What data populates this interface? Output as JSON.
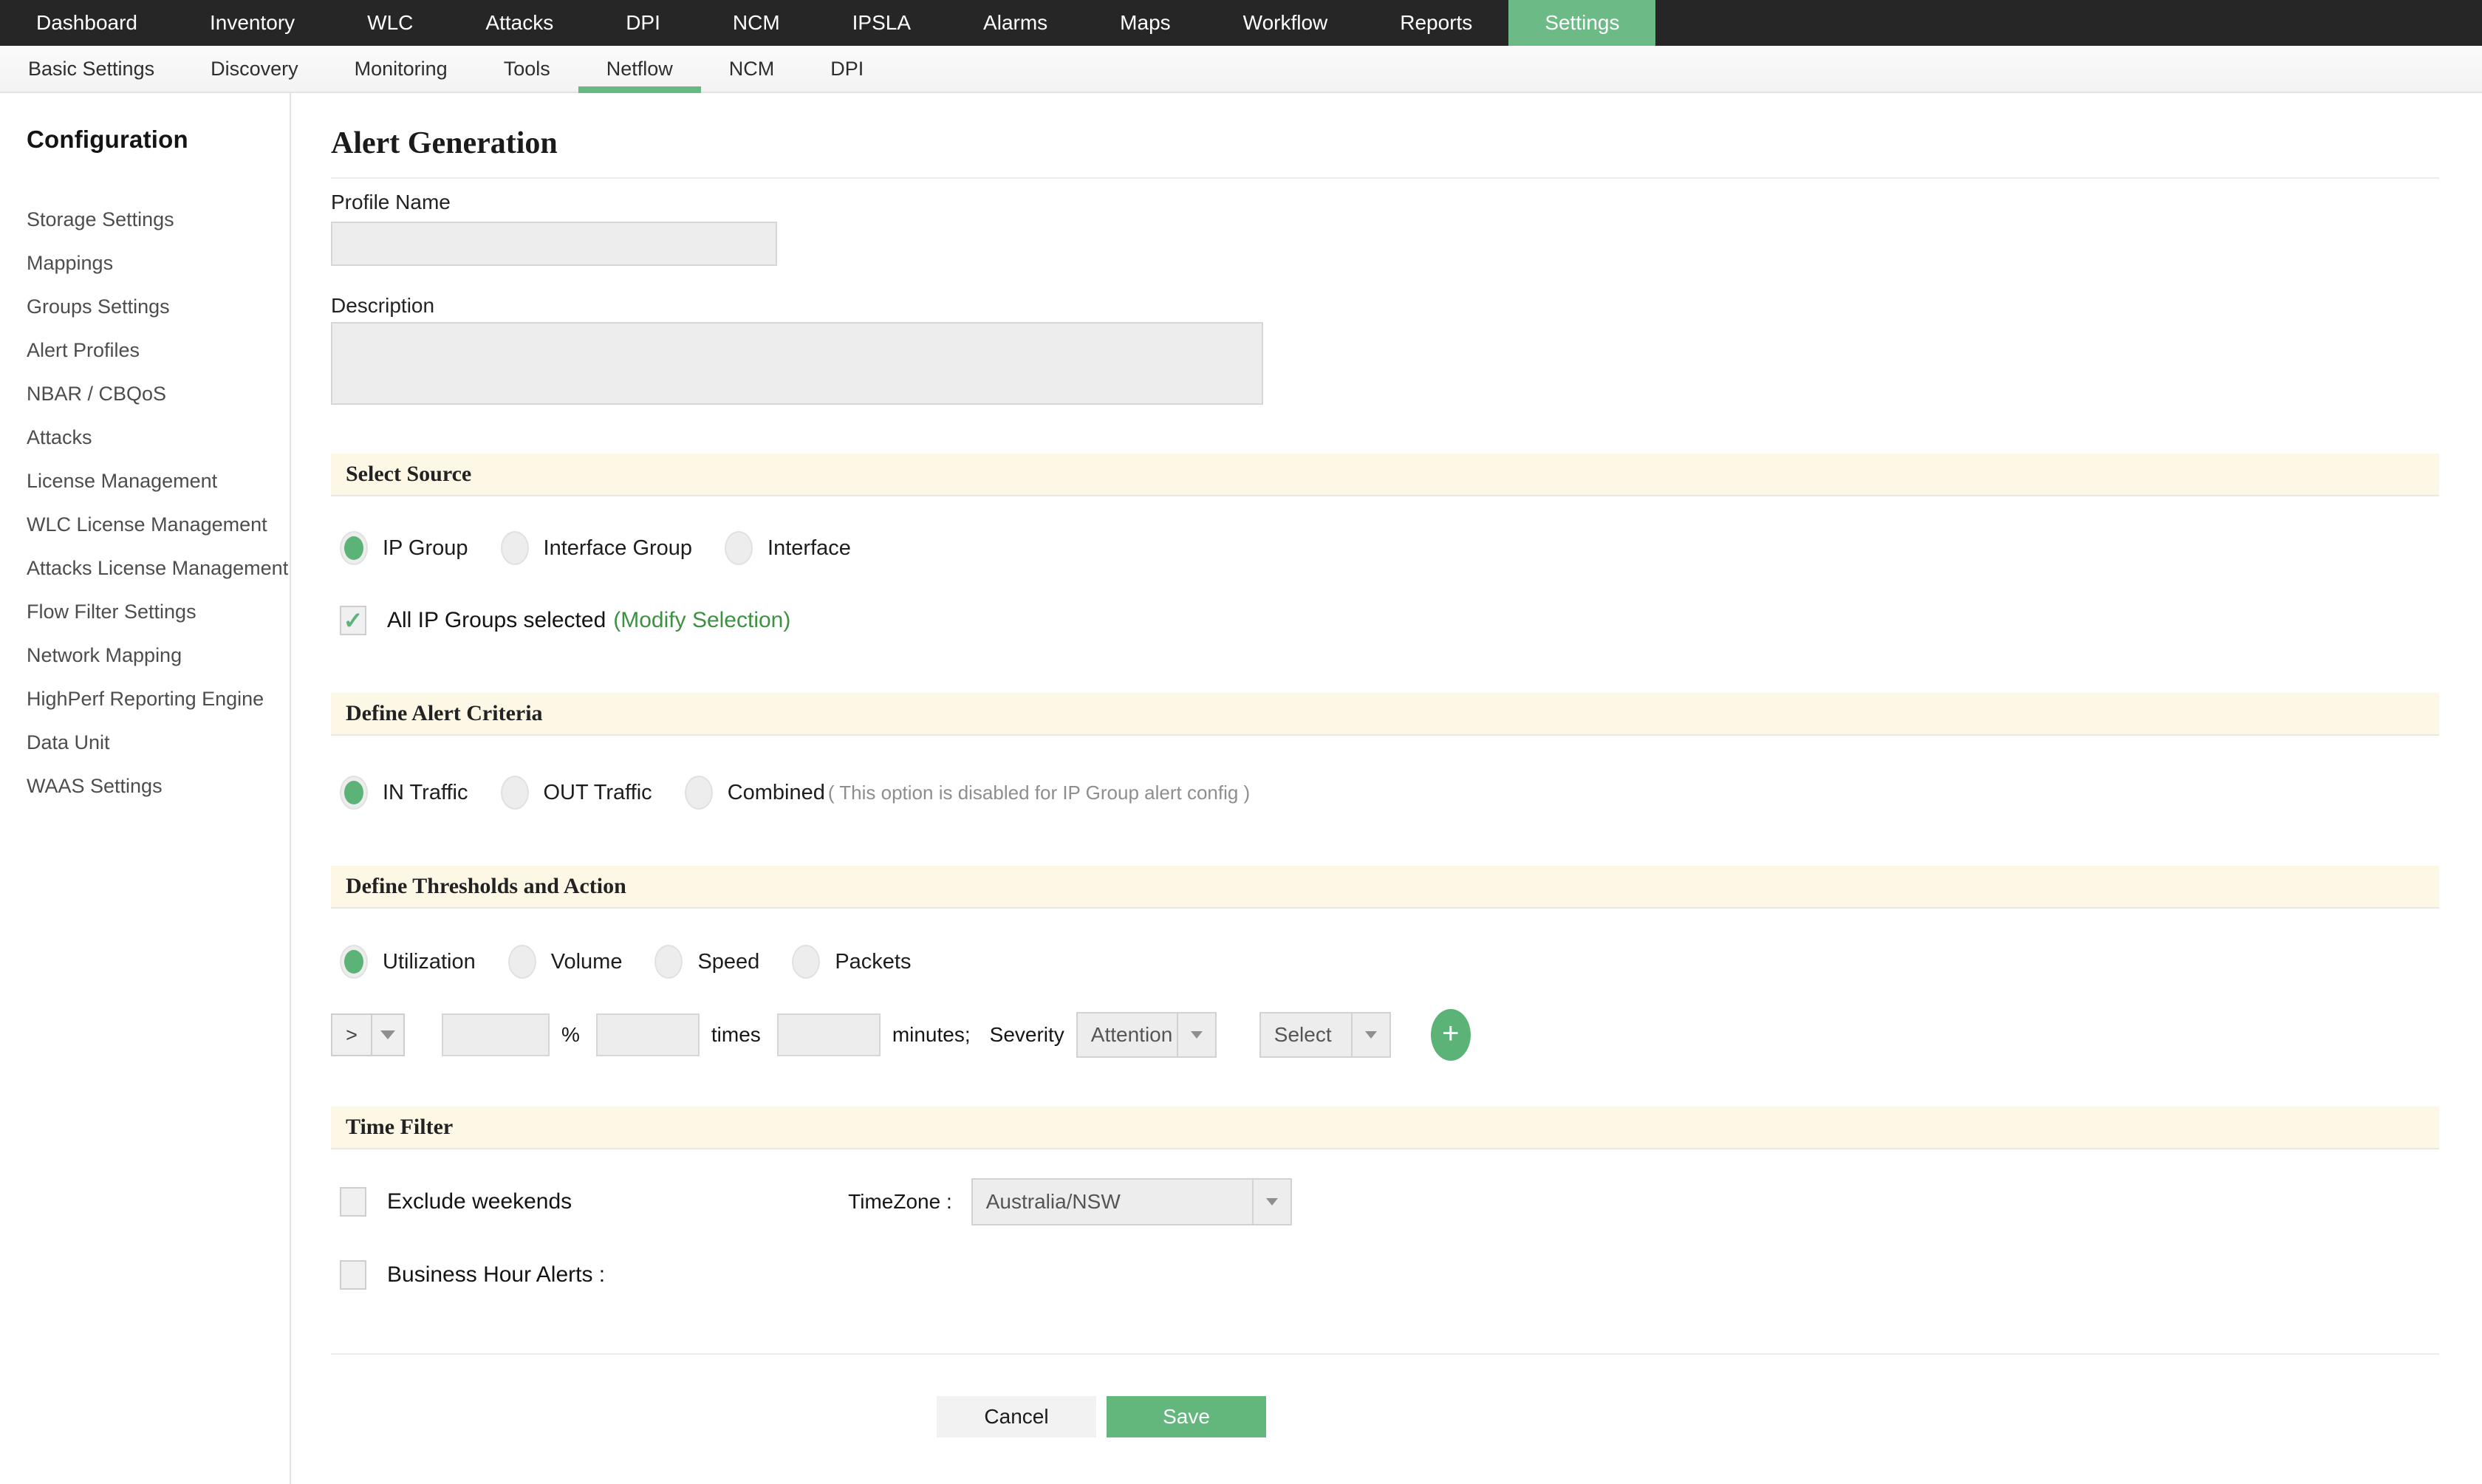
{
  "topnav": {
    "items": [
      {
        "label": "Dashboard"
      },
      {
        "label": "Inventory"
      },
      {
        "label": "WLC"
      },
      {
        "label": "Attacks"
      },
      {
        "label": "DPI"
      },
      {
        "label": "NCM"
      },
      {
        "label": "IPSLA"
      },
      {
        "label": "Alarms"
      },
      {
        "label": "Maps"
      },
      {
        "label": "Workflow"
      },
      {
        "label": "Reports"
      },
      {
        "label": "Settings"
      }
    ],
    "active": "Settings"
  },
  "subnav": {
    "items": [
      {
        "label": "Basic Settings"
      },
      {
        "label": "Discovery"
      },
      {
        "label": "Monitoring"
      },
      {
        "label": "Tools"
      },
      {
        "label": "Netflow"
      },
      {
        "label": "NCM"
      },
      {
        "label": "DPI"
      }
    ],
    "active": "Netflow"
  },
  "sidebar": {
    "title": "Configuration",
    "items": [
      {
        "label": "Storage Settings"
      },
      {
        "label": "Mappings"
      },
      {
        "label": "Groups Settings"
      },
      {
        "label": "Alert Profiles"
      },
      {
        "label": "NBAR / CBQoS"
      },
      {
        "label": "Attacks"
      },
      {
        "label": "License Management"
      },
      {
        "label": "WLC License Management"
      },
      {
        "label": "Attacks License Management"
      },
      {
        "label": "Flow Filter Settings"
      },
      {
        "label": "Network Mapping"
      },
      {
        "label": "HighPerf Reporting Engine"
      },
      {
        "label": "Data Unit"
      },
      {
        "label": "WAAS Settings"
      }
    ]
  },
  "page": {
    "title": "Alert Generation"
  },
  "form": {
    "profile_name": {
      "label": "Profile Name",
      "value": ""
    },
    "description": {
      "label": "Description",
      "value": ""
    },
    "select_source": {
      "title": "Select Source",
      "options": [
        {
          "label": "IP Group",
          "selected": true
        },
        {
          "label": "Interface Group",
          "selected": false
        },
        {
          "label": "Interface",
          "selected": false
        }
      ],
      "all_groups": {
        "label": "All IP Groups selected",
        "link": "(Modify Selection)",
        "checked": true
      }
    },
    "alert_criteria": {
      "title": "Define Alert Criteria",
      "options": [
        {
          "label": "IN Traffic",
          "selected": true
        },
        {
          "label": "OUT Traffic",
          "selected": false
        },
        {
          "label": "Combined",
          "selected": false,
          "note": "( This option is disabled for IP Group alert config )"
        }
      ]
    },
    "thresholds": {
      "title": "Define Thresholds and Action",
      "metrics": [
        {
          "label": "Utilization",
          "selected": true
        },
        {
          "label": "Volume",
          "selected": false
        },
        {
          "label": "Speed",
          "selected": false
        },
        {
          "label": "Packets",
          "selected": false
        }
      ],
      "operator": {
        "value": ">"
      },
      "percent_input": {
        "value": ""
      },
      "percent_label": "%",
      "times_input": {
        "value": ""
      },
      "times_label": "times",
      "minutes_input": {
        "value": ""
      },
      "minutes_label": "minutes;",
      "severity_label": "Severity",
      "severity_select": {
        "value": "Attention"
      },
      "action_select": {
        "value": "Select"
      }
    },
    "time_filter": {
      "title": "Time Filter",
      "exclude_weekends": {
        "label": "Exclude weekends",
        "checked": false
      },
      "timezone_label": "TimeZone :",
      "timezone_select": {
        "value": "Australia/NSW"
      },
      "business_hours": {
        "label": "Business Hour Alerts :",
        "checked": false
      }
    },
    "actions": {
      "cancel": "Cancel",
      "save": "Save"
    }
  },
  "icons": {
    "check": "✓",
    "plus": "+"
  },
  "colors": {
    "accent_green": "#63b77d",
    "link_green": "#3e9142",
    "section_band": "#fdf8e6",
    "topbar": "#262626"
  }
}
